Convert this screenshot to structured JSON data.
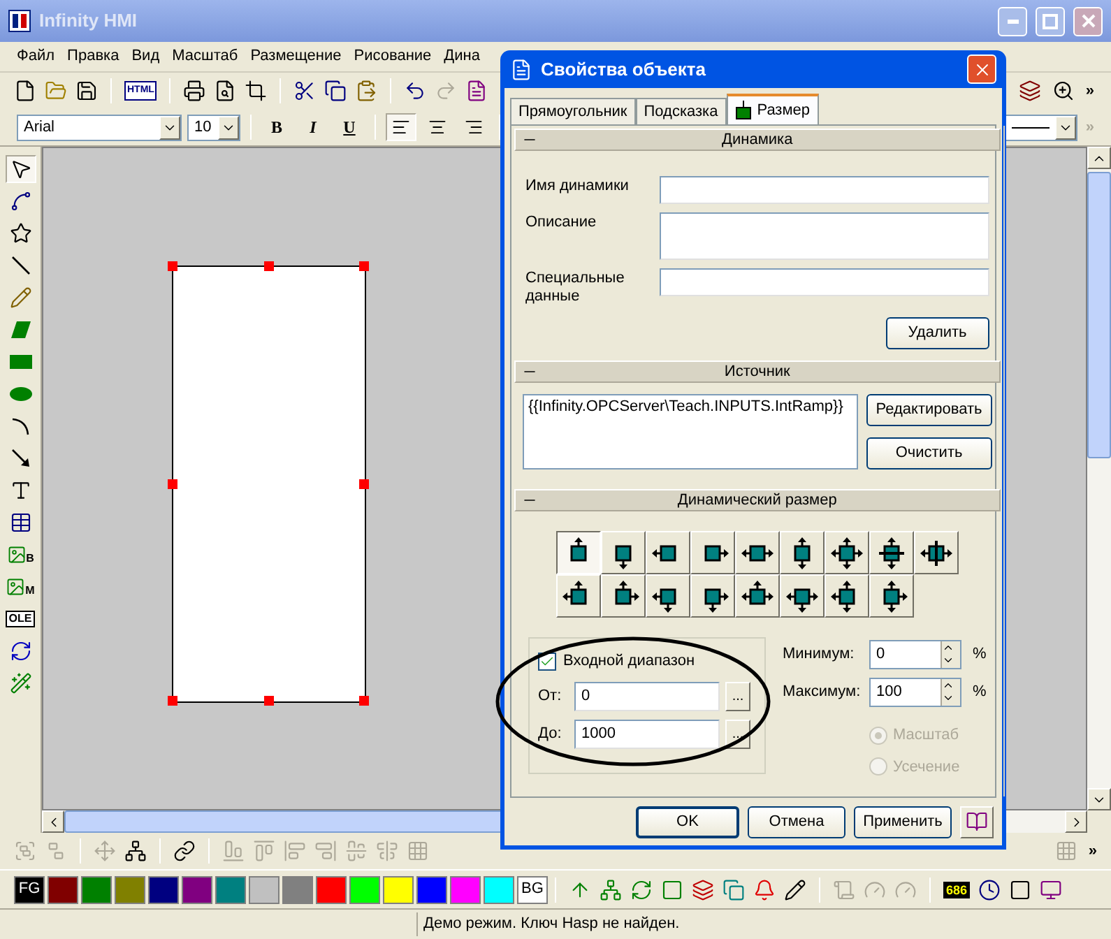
{
  "window": {
    "title": "Infinity HMI"
  },
  "menu": [
    {
      "label": "Файл"
    },
    {
      "label": "Правка"
    },
    {
      "label": "Вид"
    },
    {
      "label": "Масштаб"
    },
    {
      "label": "Размещение"
    },
    {
      "label": "Рисование"
    },
    {
      "label": "Дина"
    }
  ],
  "toolbar": {
    "html_label": "HTML",
    "overflow": "»"
  },
  "format_bar": {
    "font": "Arial",
    "size": "10",
    "styles": [
      {
        "label": "B",
        "kind": "bold"
      },
      {
        "label": "I",
        "kind": "italic"
      },
      {
        "label": "U",
        "kind": "underline"
      }
    ],
    "align": [
      {
        "kind": "left",
        "selected": true
      },
      {
        "kind": "center",
        "selected": false
      },
      {
        "kind": "right",
        "selected": false
      }
    ],
    "overflow": "»"
  },
  "tools": [
    {
      "kind": "pointer",
      "selected": true
    },
    {
      "kind": "polygon",
      "selected": false
    },
    {
      "kind": "star",
      "selected": false
    },
    {
      "kind": "line",
      "selected": false
    },
    {
      "kind": "pencil",
      "selected": false
    },
    {
      "kind": "parallelogram",
      "selected": false
    },
    {
      "kind": "rectangle",
      "selected": false
    },
    {
      "kind": "ellipse",
      "selected": false
    },
    {
      "kind": "arc",
      "selected": false
    },
    {
      "kind": "arrow",
      "selected": false
    },
    {
      "kind": "text",
      "selected": false
    },
    {
      "kind": "table",
      "selected": false
    },
    {
      "kind": "bitmap",
      "label": "B",
      "selected": false
    },
    {
      "kind": "bitmap",
      "label": "M",
      "selected": false
    },
    {
      "kind": "ole",
      "label": "OLE",
      "selected": false
    },
    {
      "kind": "refresh",
      "selected": false
    },
    {
      "kind": "wizard",
      "selected": false
    }
  ],
  "bottom_bar": {
    "overflow": "»"
  },
  "palette": {
    "fg_label": "FG",
    "bg_label": "BG",
    "colors": [
      {
        "color": "#800000"
      },
      {
        "color": "#008000"
      },
      {
        "color": "#808000"
      },
      {
        "color": "#000080"
      },
      {
        "color": "#800080"
      },
      {
        "color": "#008080"
      },
      {
        "color": "#c0c0c0"
      },
      {
        "color": "#808080"
      },
      {
        "color": "#ff0000"
      },
      {
        "color": "#00ff00"
      },
      {
        "color": "#ffff00"
      },
      {
        "color": "#0000ff"
      },
      {
        "color": "#ff00ff"
      },
      {
        "color": "#00ffff"
      }
    ]
  },
  "runtime_display": "686",
  "status_bar": {
    "message": "Демо режим. Ключ Hasp не найден."
  },
  "dialog": {
    "title": "Свойства объекта",
    "tabs": [
      {
        "label": "Прямоугольник",
        "selected": false
      },
      {
        "label": "Подсказка",
        "selected": false
      },
      {
        "label": "Размер",
        "selected": true
      }
    ],
    "dynamics": {
      "title": "Динамика",
      "fields": [
        {
          "label": "Имя динамики",
          "kind": "single"
        },
        {
          "label": "Описание",
          "kind": "multi"
        },
        {
          "label": "Специальные данные",
          "kind": "single"
        }
      ],
      "delete_button": "Удалить"
    },
    "source": {
      "title": "Источник",
      "value": "{{Infinity.OPCServer\\Teach.INPUTS.IntRamp}}",
      "buttons": [
        "Редактировать",
        "Очистить"
      ]
    },
    "dynamic_size": {
      "title": "Динамический размер",
      "modes": [
        {
          "kind": "up",
          "selected": true
        },
        {
          "kind": "down",
          "selected": false
        },
        {
          "kind": "left",
          "selected": false
        },
        {
          "kind": "right",
          "selected": false
        },
        {
          "kind": "horizontal",
          "selected": false
        },
        {
          "kind": "vertical",
          "selected": false
        },
        {
          "kind": "all",
          "selected": false
        },
        {
          "kind": "center_vertical",
          "selected": false
        },
        {
          "kind": "center_horizontal",
          "selected": false
        },
        {
          "kind": "up_left",
          "selected": false
        },
        {
          "kind": "up_right",
          "selected": false
        },
        {
          "kind": "down_left",
          "selected": false
        },
        {
          "kind": "down_right",
          "selected": false
        },
        {
          "kind": "up_sides",
          "selected": false
        },
        {
          "kind": "down_sides",
          "selected": false
        },
        {
          "kind": "vertical_left",
          "selected": false
        },
        {
          "kind": "vertical_right",
          "selected": false
        }
      ],
      "input_range": {
        "label": "Входной диапазон",
        "checked": true,
        "from_label": "От:",
        "from_value": "0",
        "from_browse": "...",
        "to_label": "До:",
        "to_value": "1000",
        "to_browse": "..."
      },
      "minimum": {
        "label": "Минимум:",
        "value": "0",
        "unit": "%"
      },
      "maximum": {
        "label": "Максимум:",
        "value": "100",
        "unit": "%"
      },
      "options": [
        {
          "label": "Масштаб",
          "selected": true,
          "disabled": true
        },
        {
          "label": "Усечение",
          "selected": false,
          "disabled": true
        }
      ]
    },
    "buttons": [
      {
        "label": "OK"
      },
      {
        "label": "Отмена"
      },
      {
        "label": "Применить"
      }
    ]
  }
}
